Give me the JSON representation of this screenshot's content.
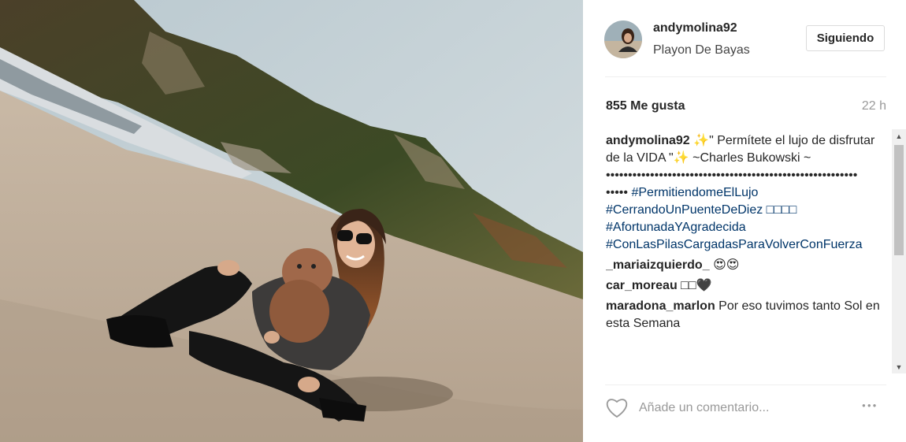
{
  "post": {
    "username": "andymolina92",
    "location": "Playon De Bayas",
    "follow_label": "Siguiendo",
    "likes": "855 Me gusta",
    "time": "22 h"
  },
  "caption": {
    "user": "andymolina92",
    "text": "✨\" Permítete el lujo de disfrutar de la VIDA \"✨ ~Charles Bukowski ~",
    "dots_line": "•••••••••••••••••••••••••••••••••••••••••••••••••••••••••",
    "dots_prefix": "•••••",
    "tags": [
      "#PermitiendomeElLujo",
      "#CerrandoUnPuenteDeDiez □□□□",
      "#AfortunadaYAgradecida",
      "#ConLasPilasCargadasParaVolverConFuerza"
    ]
  },
  "comments": [
    {
      "user": "_mariaizquierdo_",
      "text": "😍😍"
    },
    {
      "user": "car_moreau",
      "text": "□□🖤"
    },
    {
      "user": "maradona_marlon",
      "text": "Por eso tuvimos tanto Sol en esta Semana"
    }
  ],
  "comment_box": {
    "placeholder": "Añade un comentario..."
  },
  "icons": {
    "like": "heart-icon",
    "more": "more-options-icon",
    "scroll_up": "scroll-up-arrow-icon",
    "scroll_down": "scroll-down-arrow-icon"
  }
}
